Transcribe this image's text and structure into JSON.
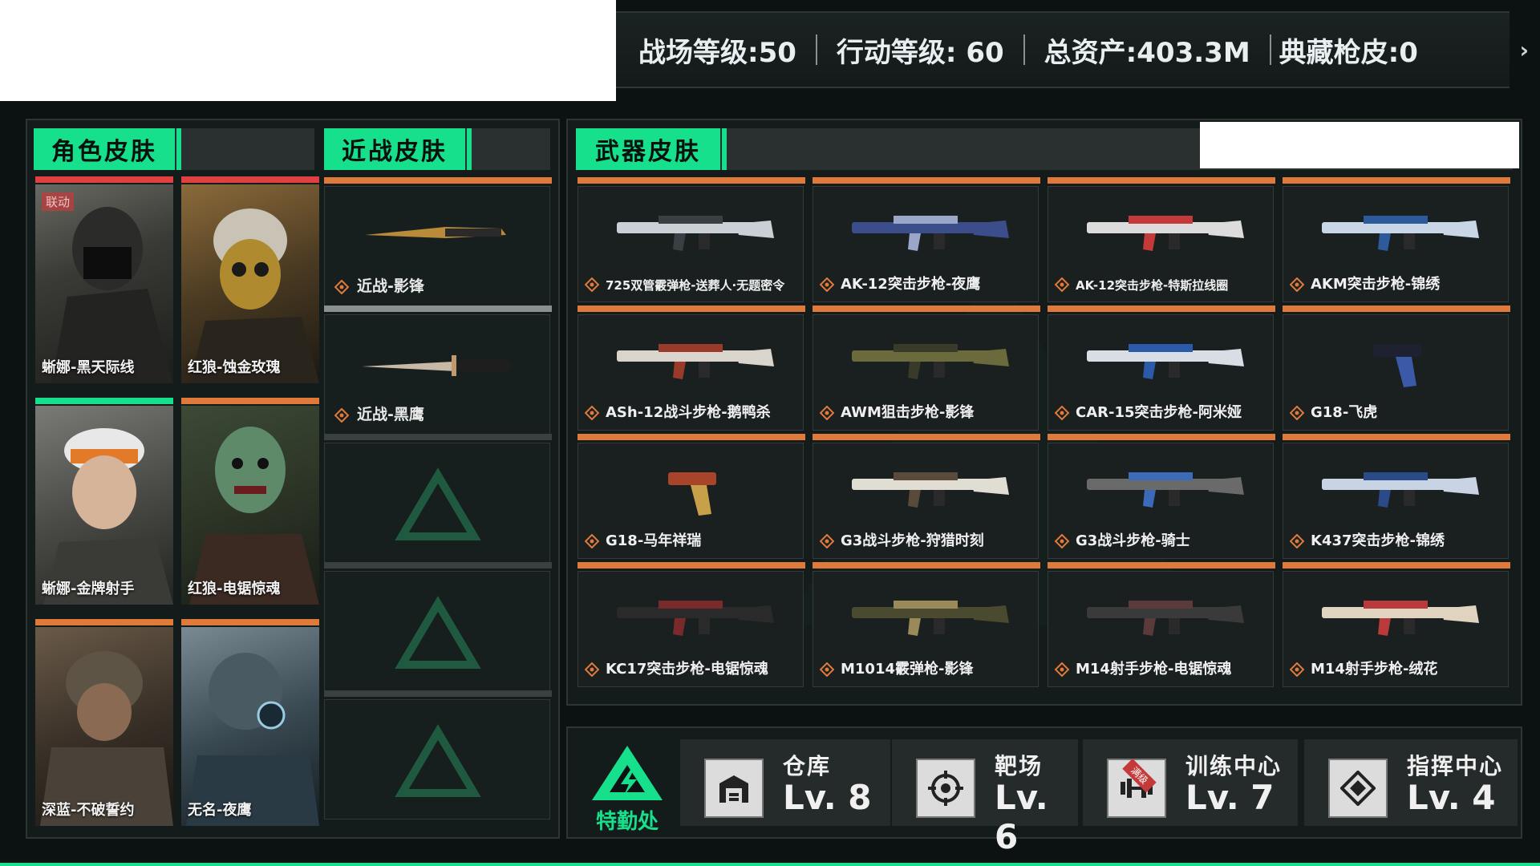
{
  "colors": {
    "accent": "#16e08c",
    "stripe_orange": "#e07a3a",
    "stripe_red": "#e04040",
    "stripe_green": "#16e08c"
  },
  "topbar": {
    "battlefield_level": "战场等级:50",
    "operation_level": "行动等级: 60",
    "total_assets": "总资产:403.3M",
    "collection_skins": "典藏枪皮:0",
    "arrow_icon": "chevron-right-icon"
  },
  "tabs": {
    "character": "角色皮肤",
    "melee": "近战皮肤",
    "weapon": "武器皮肤"
  },
  "characters": [
    {
      "name": "蜥娜-黑天际线",
      "badge": "联动",
      "stripe": "red"
    },
    {
      "name": "红狼-蚀金玫瑰",
      "stripe": "red"
    },
    {
      "name": "蜥娜-金牌射手",
      "stripe": "green"
    },
    {
      "name": "红狼-电锯惊魂",
      "stripe": "orange"
    },
    {
      "name": "深蓝-不破誓约",
      "stripe": "orange"
    },
    {
      "name": "无名-夜鹰",
      "stripe": "orange"
    }
  ],
  "melee": [
    {
      "name": "近战-影锋"
    },
    {
      "name": "近战-黑鹰"
    }
  ],
  "weapons": [
    {
      "name": "725双管霰弹枪-送葬人·无题密令"
    },
    {
      "name": "AK-12突击步枪-夜鹰"
    },
    {
      "name": "AK-12突击步枪-特斯拉线圈"
    },
    {
      "name": "AKM突击步枪-锦绣"
    },
    {
      "name": "ASh-12战斗步枪-鹅鸭杀"
    },
    {
      "name": "AWM狙击步枪-影锋"
    },
    {
      "name": "CAR-15突击步枪-阿米娅"
    },
    {
      "name": "G18-飞虎"
    },
    {
      "name": "G18-马年祥瑞"
    },
    {
      "name": "G3战斗步枪-狩猎时刻"
    },
    {
      "name": "G3战斗步枪-骑士"
    },
    {
      "name": "K437突击步枪-锦绣"
    },
    {
      "name": "KC17突击步枪-电锯惊魂"
    },
    {
      "name": "M1014霰弹枪-影锋"
    },
    {
      "name": "M14射手步枪-电锯惊魂"
    },
    {
      "name": "M14射手步枪-绒花"
    }
  ],
  "logistics": {
    "label": "特勤处",
    "icon": "triangle-logo-icon"
  },
  "facilities": [
    {
      "title": "仓库",
      "level": "Lv. 8",
      "icon": "warehouse-icon"
    },
    {
      "title": "靶场",
      "level": "Lv. 6",
      "icon": "target-icon"
    },
    {
      "title": "训练中心",
      "level": "Lv. 7",
      "icon": "dumbbell-icon",
      "ribbon": "满级"
    },
    {
      "title": "指挥中心",
      "level": "Lv. 4",
      "icon": "command-icon"
    }
  ]
}
